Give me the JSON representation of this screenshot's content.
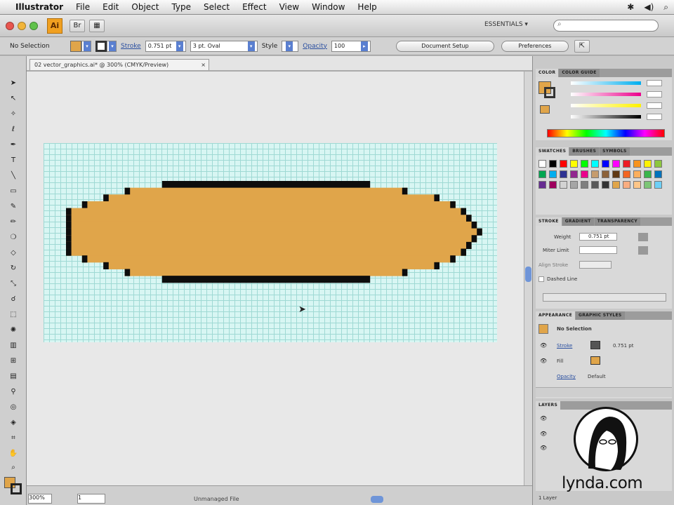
{
  "menubar": {
    "app_name": "Illustrator",
    "items": [
      "File",
      "Edit",
      "Object",
      "Type",
      "Select",
      "Effect",
      "View",
      "Window",
      "Help"
    ]
  },
  "appbar": {
    "logo_label": "Ai",
    "workspace": "ESSENTIALS ▾",
    "search_placeholder": "⌕"
  },
  "controlbar": {
    "selection": "No Selection",
    "stroke_label": "Stroke",
    "stroke_weight": "0.751 pt",
    "brush": "3 pt. Oval",
    "style_label": "Style",
    "opacity_label": "Opacity",
    "opacity_value": "100",
    "document_setup": "Document Setup",
    "preferences": "Preferences"
  },
  "document": {
    "tab_title": "02 vector_graphics.ai* @ 300% (CMYK/Preview)",
    "close": "×",
    "zoom": "300%",
    "page": "1",
    "status": "Unmanaged File"
  },
  "panels": {
    "color_tabs": [
      "COLOR",
      "COLOR GUIDE"
    ],
    "swatch_tabs": [
      "SWATCHES",
      "BRUSHES",
      "SYMBOLS"
    ],
    "stroke_tabs": [
      "STROKE",
      "GRADIENT",
      "TRANSPARENCY"
    ],
    "stroke": {
      "weight_label": "Weight",
      "weight_value": "0.751 pt",
      "miter_label": "Miter Limit",
      "align_label": "Align Stroke",
      "dashed_label": "Dashed Line"
    },
    "appearance_tabs": [
      "APPEARANCE",
      "GRAPHIC STYLES"
    ],
    "appearance": {
      "title": "No Selection",
      "stroke_label": "Stroke",
      "stroke_value": "0.751 pt",
      "fill_label": "Fill",
      "opacity_label": "Opacity",
      "opacity_value": "Default"
    },
    "layers_tabs": [
      "LAYERS"
    ],
    "layers_count": "1 Layer"
  },
  "watermark": {
    "text": "lynda.com"
  },
  "colors": {
    "fill": "#e0a54a",
    "stroke": "#0d0d0d",
    "grid_bg": "#d8f6f3",
    "grid_line": "#9fd9d4",
    "accent": "#5a7fd0"
  },
  "icons": {
    "tools": [
      "selection-arrow",
      "direct-select",
      "magic-wand",
      "lasso",
      "pen",
      "type",
      "line",
      "rectangle",
      "paintbrush",
      "pencil",
      "blob-brush",
      "eraser",
      "rotate",
      "scale",
      "warp",
      "free-transform",
      "symbol-sprayer",
      "column-graph",
      "mesh",
      "gradient",
      "eyedropper",
      "blend",
      "live-paint",
      "live-paint-select",
      "crop-area",
      "slice",
      "hand",
      "zoom"
    ]
  }
}
